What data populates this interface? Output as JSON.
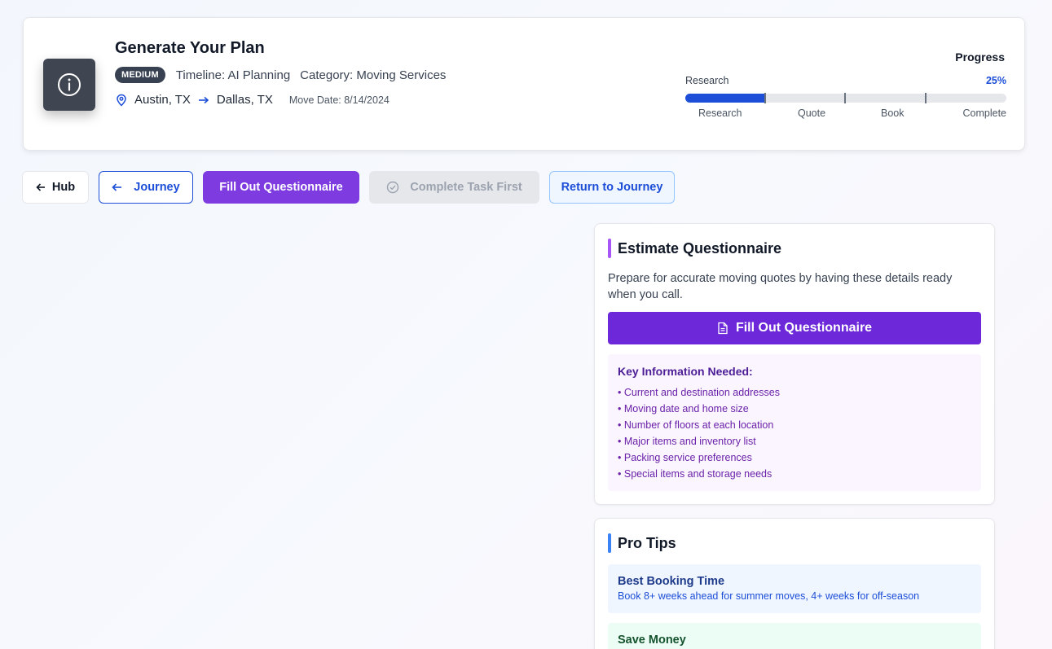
{
  "header": {
    "title": "Generate Your Plan",
    "badge": "MEDIUM",
    "timeline": "Timeline: AI Planning",
    "category": "Category: Moving Services",
    "origin": "Austin, TX",
    "destination": "Dallas, TX",
    "move_date": "Move Date: 8/14/2024",
    "icon": "info-icon"
  },
  "progress": {
    "label": "Progress",
    "current_step": "Research",
    "percent_text": "25%",
    "percent": 25,
    "steps": [
      "Research",
      "Quote",
      "Book",
      "Complete"
    ],
    "colors": {
      "fill": "#1d4ed8",
      "track": "#e5e7eb"
    }
  },
  "actions": {
    "hub": "Hub",
    "journey": "Journey",
    "fill_questionnaire": "Fill Out Questionnaire",
    "complete_task_first": "Complete Task First",
    "return_to_journey": "Return to Journey"
  },
  "questionnaire": {
    "title": "Estimate Questionnaire",
    "description": "Prepare for accurate moving quotes by having these details ready when you call.",
    "button": "Fill Out Questionnaire",
    "key_title": "Key Information Needed:",
    "items": [
      "Current and destination addresses",
      "Moving date and home size",
      "Number of floors at each location",
      "Major items and inventory list",
      "Packing service preferences",
      "Special items and storage needs"
    ]
  },
  "tips": {
    "title": "Pro Tips",
    "items": [
      {
        "title": "Best Booking Time",
        "text": "Book 8+ weeks ahead for summer moves, 4+ weeks for off-season"
      },
      {
        "title": "Save Money",
        "text": ""
      }
    ]
  },
  "colors": {
    "accent_purple": "#7e3ce0",
    "accent_blue": "#1d4ed8",
    "badge_bg": "#374151"
  }
}
